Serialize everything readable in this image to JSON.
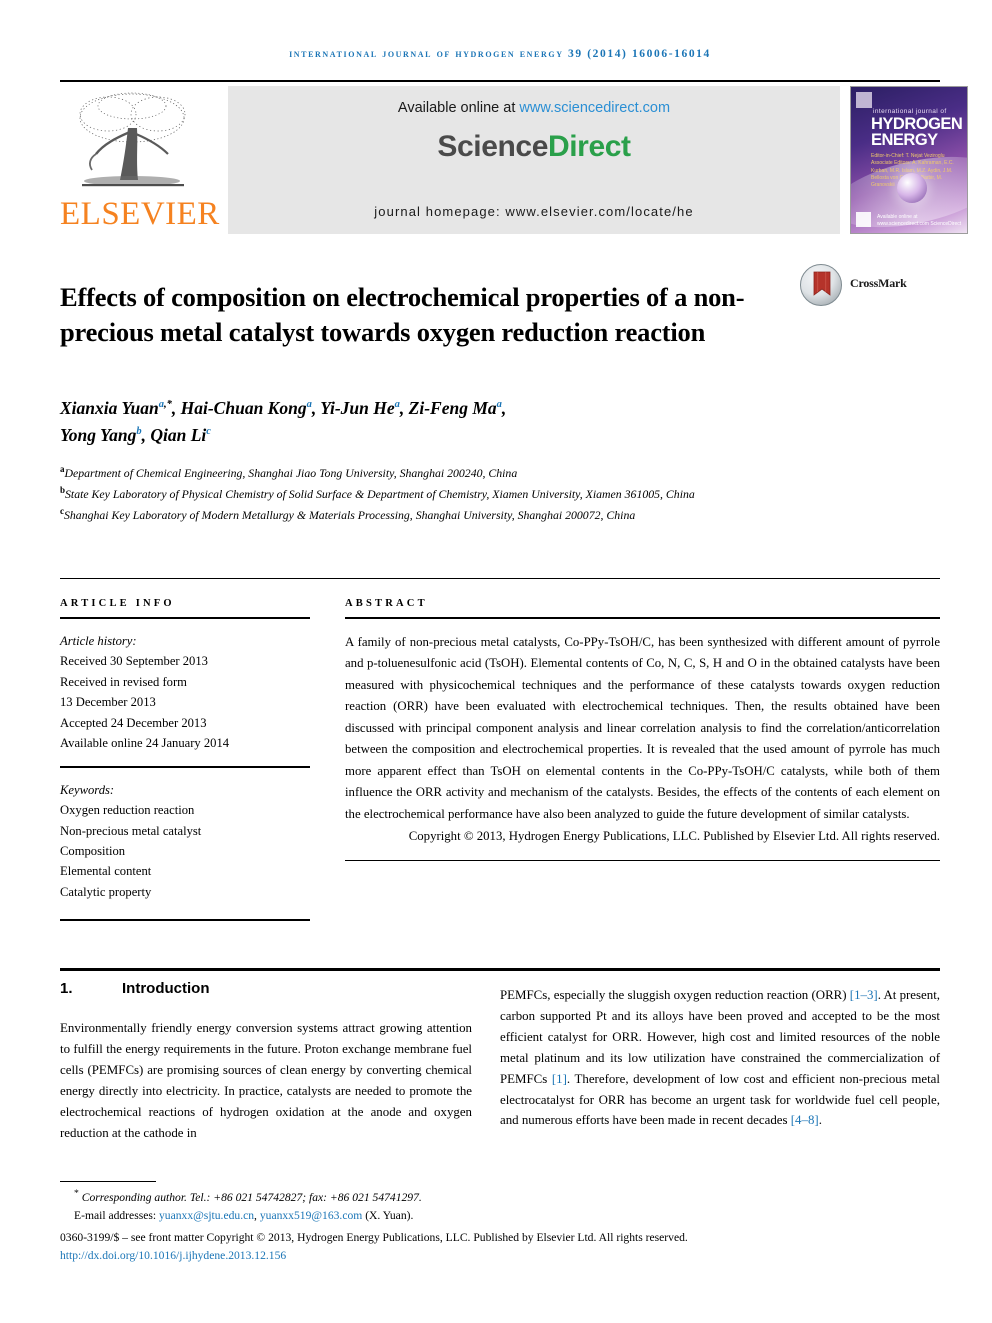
{
  "running_head": "International Journal of Hydrogen Energy 39 (2014) 16006-16014",
  "masthead": {
    "publisher_name": "ELSEVIER",
    "available_prefix": "Available online at ",
    "available_link": "www.sciencedirect.com",
    "sciencedirect_part1": "Science",
    "sciencedirect_part2": "Direct",
    "journal_homepage": "journal homepage: www.elsevier.com/locate/he",
    "cover": {
      "line_small": "international journal of",
      "title_line1": "HYDROGEN",
      "title_line2": "ENERGY",
      "meta": "Editor-in-Chief: T. Nejat Veziroglu   Associate Editors: A. Kahraman, E.C. Kurban, M.R. Islam, M.Z. Aydin, J.M. Bellosta von Colbe, F. Barbir, M. Granovskii",
      "bottom_text": "Available online at www.sciencedirect.com  ScienceDirect"
    }
  },
  "article": {
    "title": "Effects of composition on electrochemical properties of a non-precious metal catalyst towards oxygen reduction reaction",
    "crossmark_label": "CrossMark",
    "authors_line1": "Xianxia Yuan",
    "authors_line1_rest": ", Hai-Chuan Kong",
    "authors": [
      {
        "name": "Xianxia Yuan",
        "sup": "a",
        "star": true
      },
      {
        "name": "Hai-Chuan Kong",
        "sup": "a"
      },
      {
        "name": "Yi-Jun He",
        "sup": "a"
      },
      {
        "name": "Zi-Feng Ma",
        "sup": "a"
      },
      {
        "name": "Yong Yang",
        "sup": "b"
      },
      {
        "name": "Qian Li",
        "sup": "c"
      }
    ],
    "affiliations": [
      {
        "mark": "a",
        "text": "Department of Chemical Engineering, Shanghai Jiao Tong University, Shanghai 200240, China"
      },
      {
        "mark": "b",
        "text": "State Key Laboratory of Physical Chemistry of Solid Surface & Department of Chemistry, Xiamen University, Xiamen 361005, China"
      },
      {
        "mark": "c",
        "text": "Shanghai Key Laboratory of Modern Metallurgy & Materials Processing, Shanghai University, Shanghai 200072, China"
      }
    ]
  },
  "article_info": {
    "heading": "ARTICLE INFO",
    "history_label": "Article history:",
    "history": [
      "Received 30 September 2013",
      "Received in revised form",
      "13 December 2013",
      "Accepted 24 December 2013",
      "Available online 24 January 2014"
    ],
    "keywords_label": "Keywords:",
    "keywords": [
      "Oxygen reduction reaction",
      "Non-precious metal catalyst",
      "Composition",
      "Elemental content",
      "Catalytic property"
    ]
  },
  "abstract": {
    "heading": "ABSTRACT",
    "text": "A family of non-precious metal catalysts, Co-PPy-TsOH/C, has been synthesized with different amount of pyrrole and p-toluenesulfonic acid (TsOH). Elemental contents of Co, N, C, S, H and O in the obtained catalysts have been measured with physicochemical techniques and the performance of these catalysts towards oxygen reduction reaction (ORR) have been evaluated with electrochemical techniques. Then, the results obtained have been discussed with principal component analysis and linear correlation analysis to find the correlation/anticorrelation between the composition and electrochemical properties. It is revealed that the used amount of pyrrole has much more apparent effect than TsOH on elemental contents in the Co-PPy-TsOH/C catalysts, while both of them influence the ORR activity and mechanism of the catalysts. Besides, the effects of the contents of each element on the electrochemical performance have also been analyzed to guide the future development of similar catalysts.",
    "copyright": "Copyright © 2013, Hydrogen Energy Publications, LLC. Published by Elsevier Ltd. All rights reserved."
  },
  "body": {
    "section_number": "1.",
    "section_title": "Introduction",
    "left_paragraph": "Environmentally friendly energy conversion systems attract growing attention to fulfill the energy requirements in the future. Proton exchange membrane fuel cells (PEMFCs) are promising sources of clean energy by converting chemical energy directly into electricity. In practice, catalysts are needed to promote the electrochemical reactions of hydrogen oxidation at the anode and oxygen reduction at the cathode in",
    "right_seg1": "PEMFCs, especially the sluggish oxygen reduction reaction (ORR) ",
    "right_ref1": "[1–3]",
    "right_seg2": ". At present, carbon supported Pt and its alloys have been proved and accepted to be the most efficient catalyst for ORR. However, high cost and limited resources of the noble metal platinum and its low utilization have constrained the commercialization of PEMFCs ",
    "right_ref2": "[1]",
    "right_seg3": ". Therefore, development of low cost and efficient non-precious metal electrocatalyst for ORR has become an urgent task for worldwide fuel cell people, and numerous efforts have been made in recent decades ",
    "right_ref3": "[4–8]",
    "right_seg4": "."
  },
  "footer": {
    "corresponding": "Corresponding author. Tel.: +86 021 54742827; fax: +86 021 54741297.",
    "email_label": "E-mail addresses: ",
    "email1": "yuanxx@sjtu.edu.cn",
    "email_sep": ", ",
    "email2": "yuanxx519@163.com",
    "email_suffix": " (X. Yuan).",
    "issn_line": "0360-3199/$ – see front matter Copyright © 2013, Hydrogen Energy Publications, LLC. Published by Elsevier Ltd. All rights reserved.",
    "doi": "http://dx.doi.org/10.1016/j.ijhydene.2013.12.156"
  },
  "colors": {
    "accent_blue": "#1b75b6",
    "link_blue": "#2b8fd4",
    "elsevier_orange": "#f58220",
    "sciencedirect_green": "#2aa04a",
    "band_grey": "#e6e6e6"
  }
}
